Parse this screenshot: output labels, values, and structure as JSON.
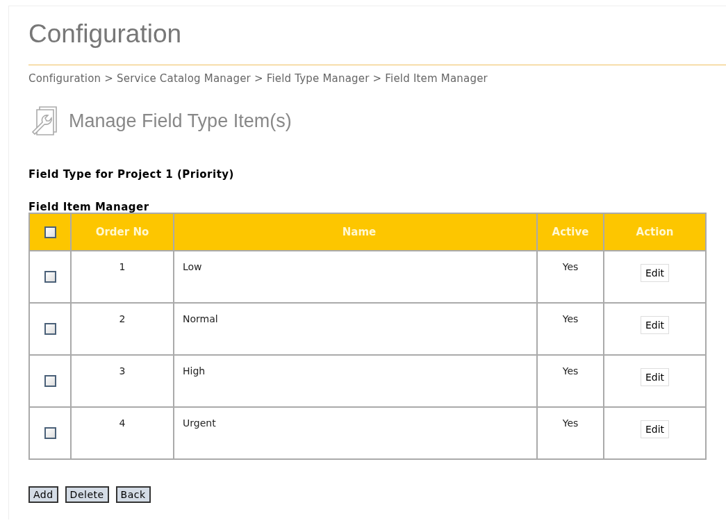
{
  "page_title": "Configuration",
  "breadcrumb": "Configuration > Service Catalog Manager > Field Type Manager > Field Item Manager",
  "section_title": "Manage Field Type Item(s)",
  "field_type_heading": "Field Type for Project 1 (Priority)",
  "table": {
    "title": "Field Item Manager",
    "select_all_checked": false,
    "columns": [
      "Order No",
      "Name",
      "Active",
      "Action"
    ],
    "rows": [
      {
        "checked": false,
        "order_no": "1",
        "name": "Low",
        "active": "Yes",
        "action": "Edit"
      },
      {
        "checked": false,
        "order_no": "2",
        "name": "Normal",
        "active": "Yes",
        "action": "Edit"
      },
      {
        "checked": false,
        "order_no": "3",
        "name": "High",
        "active": "Yes",
        "action": "Edit"
      },
      {
        "checked": false,
        "order_no": "4",
        "name": "Urgent",
        "active": "Yes",
        "action": "Edit"
      }
    ]
  },
  "buttons": [
    "Add",
    "Delete",
    "Back"
  ]
}
